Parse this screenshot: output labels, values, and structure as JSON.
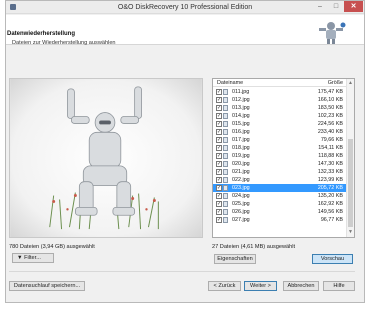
{
  "window": {
    "title": "O&O DiskRecovery 10 Professional Edition",
    "min_glyph": "–",
    "max_glyph": "□",
    "close_glyph": "✕"
  },
  "header": {
    "title": "Datenwiederherstellung",
    "subtitle": "Dateien zur Wiederherstellung auswählen",
    "logo_icon": "robot-logo-icon"
  },
  "preview": {
    "image_icon": "robot-photo"
  },
  "file_list": {
    "col_name": "Dateiname",
    "col_size": "Größe",
    "rows": [
      {
        "name": "011.jpg",
        "size": "175,47 KB",
        "checked": true,
        "selected": false
      },
      {
        "name": "012.jpg",
        "size": "166,10 KB",
        "checked": true,
        "selected": false
      },
      {
        "name": "013.jpg",
        "size": "183,50 KB",
        "checked": true,
        "selected": false
      },
      {
        "name": "014.jpg",
        "size": "102,23 KB",
        "checked": true,
        "selected": false
      },
      {
        "name": "015.jpg",
        "size": "224,56 KB",
        "checked": true,
        "selected": false
      },
      {
        "name": "016.jpg",
        "size": "233,40 KB",
        "checked": true,
        "selected": false
      },
      {
        "name": "017.jpg",
        "size": "79,66 KB",
        "checked": true,
        "selected": false
      },
      {
        "name": "018.jpg",
        "size": "154,11 KB",
        "checked": true,
        "selected": false
      },
      {
        "name": "019.jpg",
        "size": "118,88 KB",
        "checked": true,
        "selected": false
      },
      {
        "name": "020.jpg",
        "size": "147,30 KB",
        "checked": true,
        "selected": false
      },
      {
        "name": "021.jpg",
        "size": "132,33 KB",
        "checked": true,
        "selected": false
      },
      {
        "name": "022.jpg",
        "size": "123,99 KB",
        "checked": true,
        "selected": false
      },
      {
        "name": "023.jpg",
        "size": "205,72 KB",
        "checked": true,
        "selected": true
      },
      {
        "name": "024.jpg",
        "size": "135,20 KB",
        "checked": true,
        "selected": false
      },
      {
        "name": "025.jpg",
        "size": "162,92 KB",
        "checked": true,
        "selected": false
      },
      {
        "name": "026.jpg",
        "size": "149,56 KB",
        "checked": true,
        "selected": false
      },
      {
        "name": "027.jpg",
        "size": "96,77 KB",
        "checked": true,
        "selected": false
      }
    ],
    "scroll_up": "▲",
    "scroll_down": "▼"
  },
  "status": {
    "left": "780 Dateien (3,94 GB) ausgewählt",
    "right": "27 Dateien (4,61 MB) ausgewählt"
  },
  "buttons": {
    "filter": "▼    Filter...",
    "properties": "Eigenschaften",
    "preview": "Vorschau",
    "save_scan": "Datensuchlauf speichern...",
    "back": "< Zurück",
    "next": "Weiter >",
    "cancel": "Abbrechen",
    "help": "Hilfe"
  },
  "colors": {
    "selection": "#3399ff",
    "close_button": "#c75050",
    "accent_button": "#cce4f7"
  }
}
